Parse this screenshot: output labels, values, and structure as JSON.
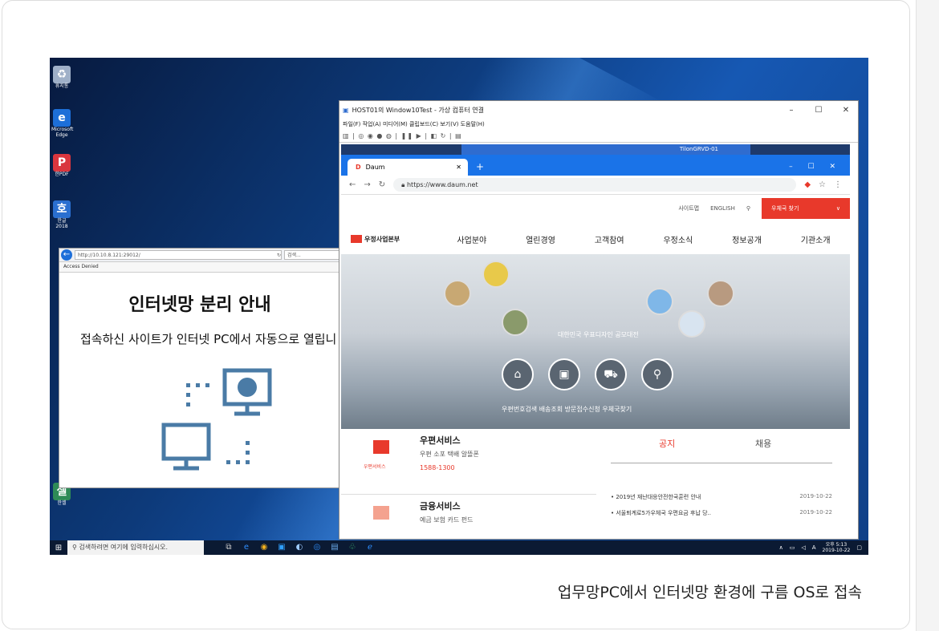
{
  "caption": "업무망PC에서 인터넷망 환경에 구름 OS로 접속",
  "colors": {
    "accent": "#e8392b",
    "chrome_blue": "#1a73e8",
    "network_icon": "#4a7ba6"
  },
  "desktop": {
    "icons": [
      {
        "label": "휴지통",
        "icon": "recycle-bin-icon",
        "color": "#9fb0c8",
        "glyph": "♻"
      },
      {
        "label": "Microsoft Edge",
        "icon": "edge-icon",
        "color": "#1d6fd8",
        "glyph": "e"
      },
      {
        "label": "한PDF",
        "icon": "pdf-icon",
        "color": "#d9363e",
        "glyph": "P"
      },
      {
        "label": "한글 2018",
        "icon": "hwp-icon",
        "color": "#2a6fd0",
        "glyph": "호"
      },
      {
        "label": "한셀",
        "icon": "hancell-icon",
        "color": "#2e8b57",
        "glyph": "셀"
      }
    ]
  },
  "ie_window": {
    "address": "http://10.10.8.121:29012/",
    "search": "검색...",
    "tab": "Access Denied",
    "heading": "인터넷망 분리 안내",
    "message": "접속하신 사이트가 인터넷 PC에서 자동으로 열립니"
  },
  "hyperv": {
    "title": "HOST01의 Window10Test - 가상 컴퓨터 연결",
    "menu": "파일(F)  작업(A)  미디어(M)  클립보드(C)  보기(V)  도움말(H)",
    "vm_bar": "TilonGRVD-01"
  },
  "chrome": {
    "tab_title": "Daum",
    "url": "https://www.daum.net"
  },
  "site": {
    "util": [
      "사이트맵",
      "ENGLISH"
    ],
    "find": "우체국 찾기",
    "logo": "우정사업본부",
    "menu": [
      "사업분야",
      "열린경영",
      "고객참여",
      "우정소식",
      "정보공개",
      "기관소개"
    ],
    "hero_caption": "대한민국 우표디자인 공모대전",
    "hero_buttons": [
      {
        "icon": "home-search-icon",
        "glyph": "⌂"
      },
      {
        "icon": "parcel-icon",
        "glyph": "▣"
      },
      {
        "icon": "truck-icon",
        "glyph": "⛟"
      },
      {
        "icon": "map-pin-icon",
        "glyph": "⚲"
      }
    ],
    "hero_labels": "우편번호검색   배송조회   방문접수신청   우체국찾기",
    "services": [
      {
        "title": "우편서비스",
        "sub": "우편 소포 택배 알뜰폰",
        "tel": "1588-1300",
        "cap": "우편서비스"
      },
      {
        "title": "금융서비스",
        "sub": "예금 보험 카드 펀드",
        "tel": "",
        "cap": ""
      }
    ],
    "notice_tabs": [
      "공지",
      "채용"
    ],
    "notices": [
      {
        "text": "• 2019년 재난대응안전한국훈련 안내",
        "date": "2019-10-22"
      },
      {
        "text": "• 서울퇴계로5가우체국 우편요금 후납 당..",
        "date": "2019-10-22"
      }
    ]
  },
  "taskbar": {
    "search": "검색하려면 여기에 입력하십시오.",
    "time": "오후 5:13",
    "date": "2019-10-22",
    "lang": "A"
  }
}
